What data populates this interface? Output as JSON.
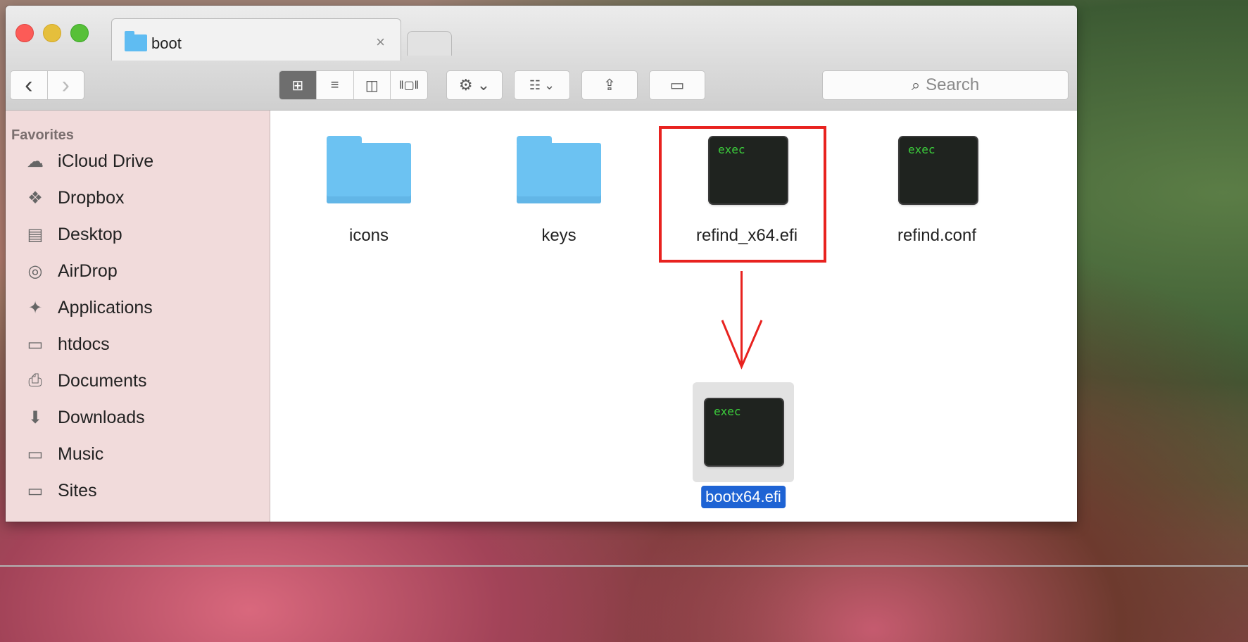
{
  "window": {
    "tab_title": "boot",
    "tab_close": "×"
  },
  "toolbar": {
    "back": "‹",
    "forward": "›",
    "view_icon": "⊞",
    "view_list": "≡",
    "view_columns": "◫",
    "view_coverflow": "‖▢‖",
    "action": "⚙ ⌄",
    "arrange": "☷ ⌄",
    "share": "⇪",
    "tags": "▭",
    "search_icon": "⌕",
    "search_placeholder": "Search"
  },
  "sidebar": {
    "heading": "Favorites",
    "items": [
      {
        "label": "iCloud Drive",
        "icon": "☁"
      },
      {
        "label": "Dropbox",
        "icon": "❖"
      },
      {
        "label": "Desktop",
        "icon": "▤"
      },
      {
        "label": "AirDrop",
        "icon": "◎"
      },
      {
        "label": "Applications",
        "icon": "✦"
      },
      {
        "label": "htdocs",
        "icon": "▭"
      },
      {
        "label": "Documents",
        "icon": "⎙"
      },
      {
        "label": "Downloads",
        "icon": "⬇"
      },
      {
        "label": "Music",
        "icon": "▭"
      },
      {
        "label": "Sites",
        "icon": "▭"
      }
    ]
  },
  "files": [
    {
      "name": "icons",
      "kind": "folder"
    },
    {
      "name": "keys",
      "kind": "folder"
    },
    {
      "name": "refind_x64.efi",
      "kind": "exec",
      "icon_text": "exec"
    },
    {
      "name": "refind.conf",
      "kind": "exec",
      "icon_text": "exec"
    }
  ],
  "renamed": {
    "name": "bootx64.efi",
    "icon_text": "exec"
  },
  "annotation_color": "#e8221f"
}
